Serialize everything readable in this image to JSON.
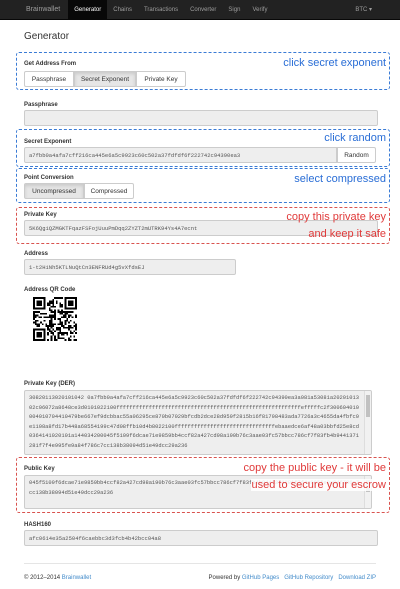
{
  "nav": {
    "brand": "Brainwallet",
    "items": [
      "Generator",
      "Chains",
      "Transactions",
      "Converter",
      "Sign",
      "Verify"
    ],
    "currency": "BTC ▾"
  },
  "page_title": "Generator",
  "get_address_from": {
    "label": "Get Address From",
    "options": [
      "Passphrase",
      "Secret Exponent",
      "Private Key"
    ],
    "selected": "Secret Exponent"
  },
  "passphrase": {
    "label": "Passphrase",
    "value": ""
  },
  "secret_exponent": {
    "label": "Secret Exponent",
    "value": "a7fbb0a4afa7cff216ca445e6a5c9923c60c502a37fdfdf6f222742c94390ea3",
    "random_label": "Random"
  },
  "point_conversion": {
    "label": "Point Conversion",
    "options": [
      "Uncompressed",
      "Compressed"
    ],
    "selected": "Uncompressed"
  },
  "private_key": {
    "label": "Private Key",
    "value": "5K6QgiQZMGKTFqazFSFojUuuPmDqq2ZYZT2mUTRK94Ys4A7ecnt"
  },
  "address": {
    "label": "Address",
    "value": "1-t2HiNh5KTLNuQtCn3ENFRUd4g5vXfdsEJ"
  },
  "qr": {
    "label": "Address QR Code"
  },
  "private_key_der": {
    "label": "Private Key (DER)",
    "value": "30820113020101042 0a7fbb0a4afa7cff216ca445e6a5c9923c60c502a37fdfdf6f222742c94390ea3a081a53081a2020101302c06072a8648ce3d0101022100fffffffffffffffffffffffffffffffffffffffffffffffffffffffffefffffc2f300604010004010704410479be667ef9dcbbac55a06295ce870b07029bfcdb2dce28d959f2815b16f81798483ada7726a3c4655da4fbfc0e1108a8fd17b448a68554199c47d08ffb10d4b8022100fffffffffffffffffffffffffffffffebaaedce6af48a03bbfd25e8cd0364141020101a144034200045f5109f6dcae71e9859bb4ccf82a427cd98a190b76c3aae03fc57bbcc786cf7f83fb4b9441371281f7f4e995fe9a84f786c7cc138b38094d51e49dcc29a236"
  },
  "public_key": {
    "label": "Public Key",
    "value": "045f5109f6dcae71e9859bb4ccf82a427cd98a190b76c3aae03fc57bbcc786cf7f83fb4b9441371281f7f4e995fe9a84f786c7cc138b38094d51e49dcc29a236"
  },
  "hash160": {
    "label": "HASH160",
    "value": "afc0614e35a2504f6caebbc3d3fcb4b42bcc04a8"
  },
  "annotations": {
    "secret_exponent": "click secret exponent",
    "random": "click random",
    "compressed": "select compressed",
    "private_key_line1": "copy this private key",
    "private_key_line2": "and keep it safe",
    "public_key_line1": "copy the public key - it will be",
    "public_key_line2": "used to secure your escrow"
  },
  "footer": {
    "copyright": "© 2012–2014",
    "brainwallet": "Brainwallet",
    "powered_by": "Powered by",
    "github_pages": "GitHub Pages",
    "github_repository": "GitHub Repository",
    "download_zip": "Download ZIP"
  },
  "colors": {
    "navbar": "#222222",
    "annotation_blue": "#2a6ed6",
    "annotation_red": "#e03a3a",
    "link": "#428bca"
  }
}
